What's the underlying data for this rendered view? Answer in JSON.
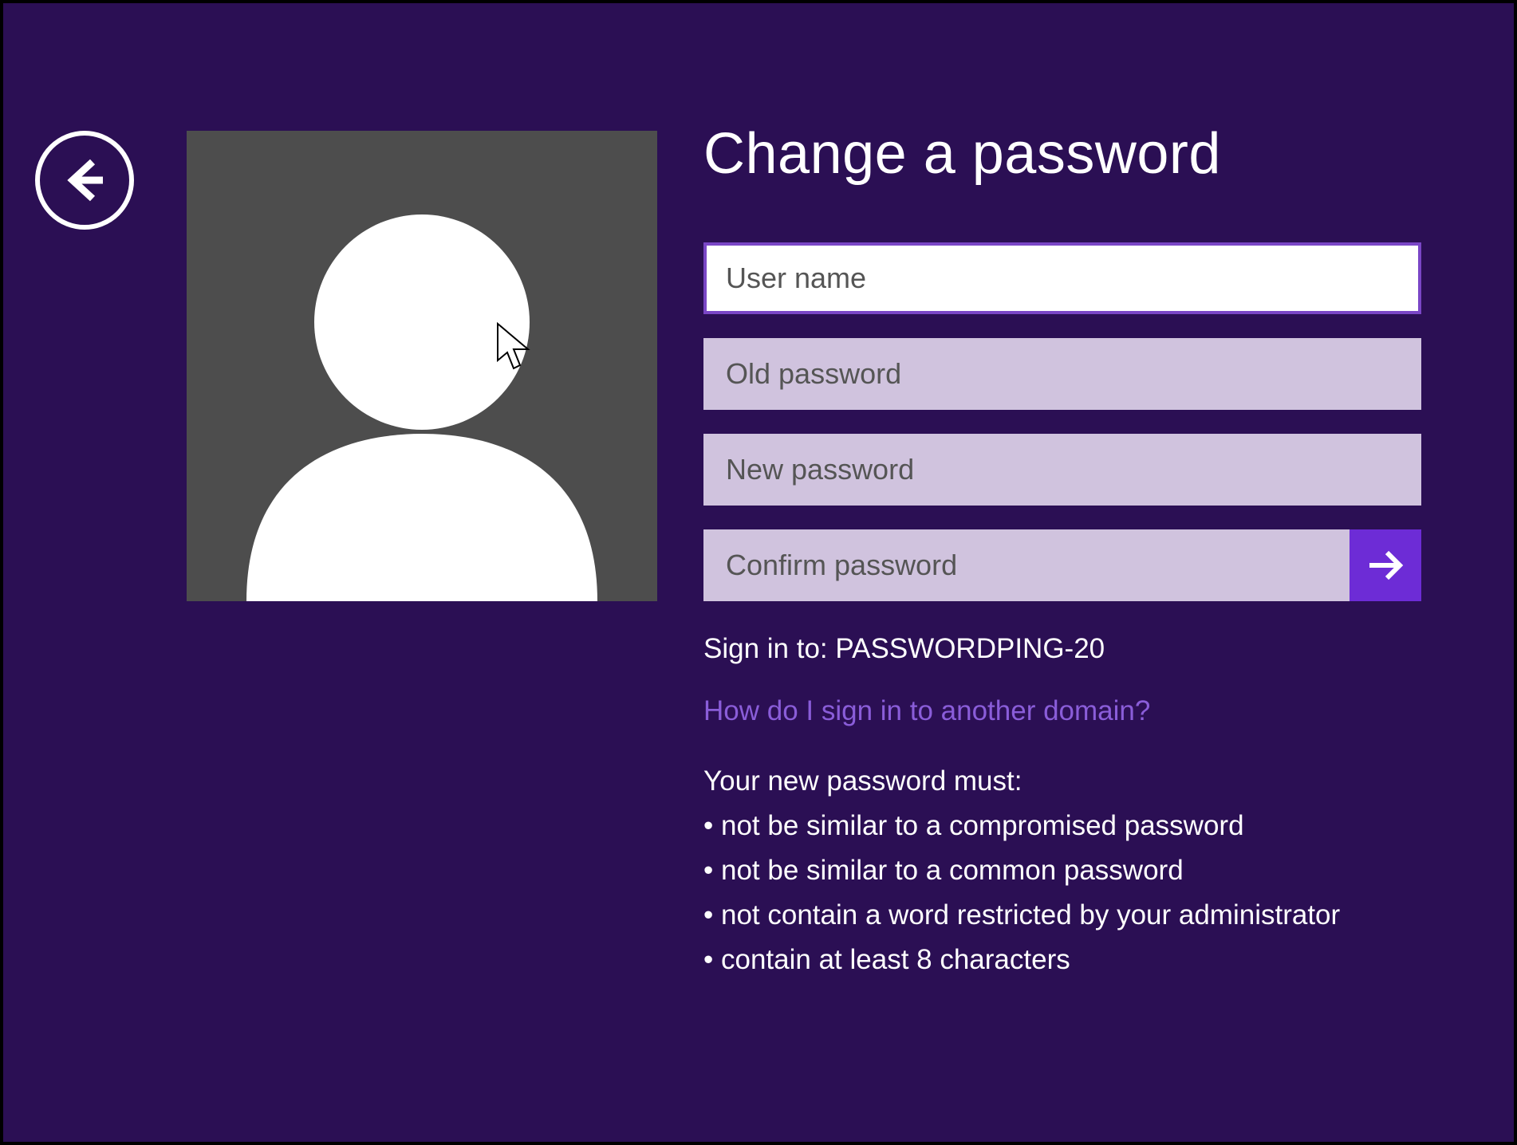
{
  "title": "Change a password",
  "fields": {
    "username_placeholder": "User name",
    "old_password_placeholder": "Old password",
    "new_password_placeholder": "New password",
    "confirm_password_placeholder": "Confirm password"
  },
  "signin_prefix": "Sign in to: ",
  "signin_domain": "PASSWORDPING-20",
  "help_link": "How do I sign in to another domain?",
  "rules_intro": "Your new password must:",
  "rules": [
    "not be similar to a compromised password",
    "not be similar to a common password",
    "not contain a word restricted by your administrator",
    "contain at least 8 characters"
  ],
  "icons": {
    "back": "arrow-left",
    "submit": "arrow-right",
    "avatar": "user"
  },
  "colors": {
    "background": "#2b0f54",
    "accent": "#6d2cd6",
    "link": "#8a5dd9",
    "field_inactive": "#d0c3de"
  }
}
